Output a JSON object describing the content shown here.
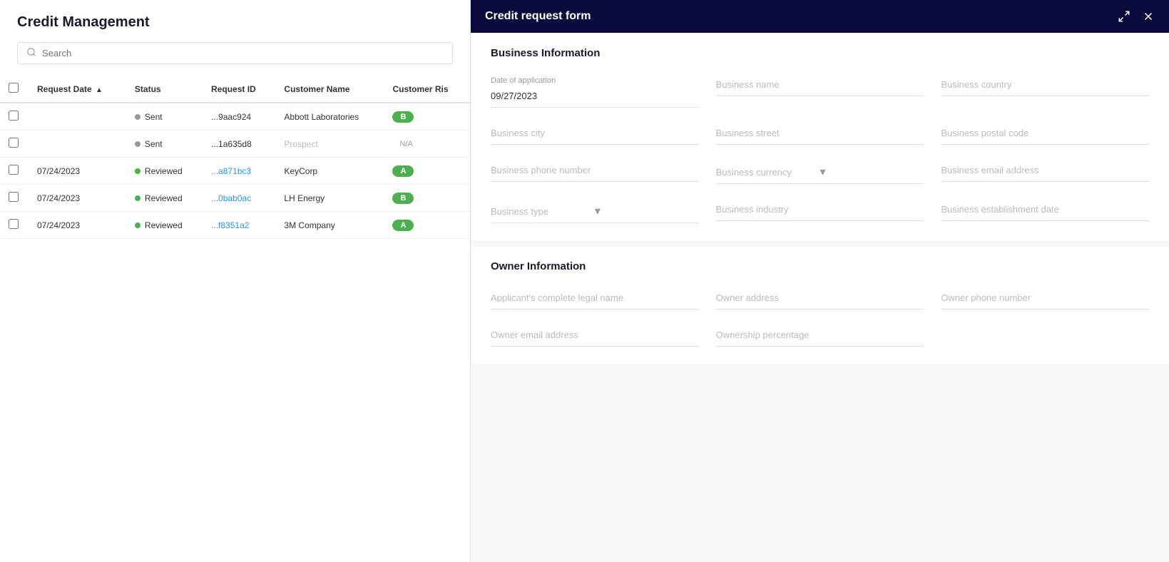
{
  "leftPanel": {
    "title": "Credit Management",
    "search": {
      "placeholder": "Search"
    },
    "table": {
      "columns": [
        {
          "id": "checkbox",
          "label": ""
        },
        {
          "id": "requestDate",
          "label": "Request Date",
          "sorted": "asc"
        },
        {
          "id": "status",
          "label": "Status"
        },
        {
          "id": "requestId",
          "label": "Request ID"
        },
        {
          "id": "customerName",
          "label": "Customer Name"
        },
        {
          "id": "customerRisk",
          "label": "Customer Ris"
        }
      ],
      "rows": [
        {
          "id": "row1",
          "requestDate": "",
          "status": "Sent",
          "statusDot": "gray",
          "requestId": "...9aac924",
          "customerName": "Abbott Laboratories",
          "risk": "B",
          "riskStyle": "badge-b",
          "linked": false
        },
        {
          "id": "row2",
          "requestDate": "",
          "status": "Sent",
          "statusDot": "gray",
          "requestId": "...1a635d8",
          "customerName": "Prospect",
          "risk": "N/A",
          "riskStyle": "badge-na",
          "linked": false,
          "prospect": true
        },
        {
          "id": "row3",
          "requestDate": "07/24/2023",
          "status": "Reviewed",
          "statusDot": "green",
          "requestId": "...a871bc3",
          "customerName": "KeyCorp",
          "risk": "A",
          "riskStyle": "badge-a",
          "linked": true
        },
        {
          "id": "row4",
          "requestDate": "07/24/2023",
          "status": "Reviewed",
          "statusDot": "green",
          "requestId": "...0bab0ac",
          "customerName": "LH Energy",
          "risk": "B",
          "riskStyle": "badge-b",
          "linked": true
        },
        {
          "id": "row5",
          "requestDate": "07/24/2023",
          "status": "Reviewed",
          "statusDot": "green",
          "requestId": "...f8351a2",
          "customerName": "3M Company",
          "risk": "A",
          "riskStyle": "badge-a",
          "linked": true
        }
      ]
    }
  },
  "rightPanel": {
    "header": {
      "title": "Credit request form",
      "expandIcon": "expand",
      "closeIcon": "close"
    },
    "businessSection": {
      "title": "Business Information",
      "fields": {
        "dateOfApplication": {
          "label": "Date of application",
          "value": "09/27/2023"
        },
        "businessName": {
          "placeholder": "Business name"
        },
        "businessCountry": {
          "placeholder": "Business country"
        },
        "businessCity": {
          "placeholder": "Business city"
        },
        "businessStreet": {
          "placeholder": "Business street"
        },
        "businessPostalCode": {
          "placeholder": "Business postal code"
        },
        "businessPhoneNumber": {
          "placeholder": "Business phone number"
        },
        "businessCurrency": {
          "placeholder": "Business currency"
        },
        "businessEmailAddress": {
          "placeholder": "Business email address"
        },
        "businessType": {
          "placeholder": "Business type"
        },
        "businessIndustry": {
          "placeholder": "Business industry"
        },
        "businessEstablishmentDate": {
          "placeholder": "Business establishment date"
        }
      }
    },
    "ownerSection": {
      "title": "Owner Information",
      "fields": {
        "applicantLegalName": {
          "placeholder": "Applicant's complete legal name"
        },
        "ownerAddress": {
          "placeholder": "Owner address"
        },
        "ownerPhoneNumber": {
          "placeholder": "Owner phone number"
        },
        "ownerEmailAddress": {
          "placeholder": "Owner email address"
        },
        "ownershipPercentage": {
          "placeholder": "Ownership percentage"
        }
      }
    }
  }
}
